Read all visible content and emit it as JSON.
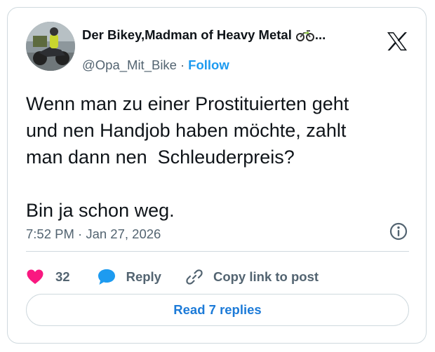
{
  "author": {
    "display_name": "Der Bikey,Madman of Heavy Metal",
    "name_emoji": "motorcycle-emoji",
    "name_truncation": "...",
    "handle": "@Opa_Mit_Bike",
    "separator": "·",
    "follow_label": "Follow"
  },
  "platform_logo": "x-logo-icon",
  "tweet": {
    "text": "Wenn man zu einer Prostituierten geht\nund nen Handjob haben möchte, zahlt\nman dann nen  Schleuderpreis?\n\nBin ja schon weg.",
    "timestamp": "7:52 PM · Jan 27, 2026"
  },
  "actions": {
    "like_count": "32",
    "reply_label": "Reply",
    "copy_link_label": "Copy link to post"
  },
  "footer": {
    "read_replies_label": "Read 7 replies"
  },
  "colors": {
    "heart": "#f91880",
    "reply_bubble": "#1d9bf0",
    "follow": "#1d9bf0",
    "read_replies": "#1d7bd8",
    "text_primary": "#0f1419",
    "text_secondary": "#536471",
    "border": "#cfd9de"
  }
}
